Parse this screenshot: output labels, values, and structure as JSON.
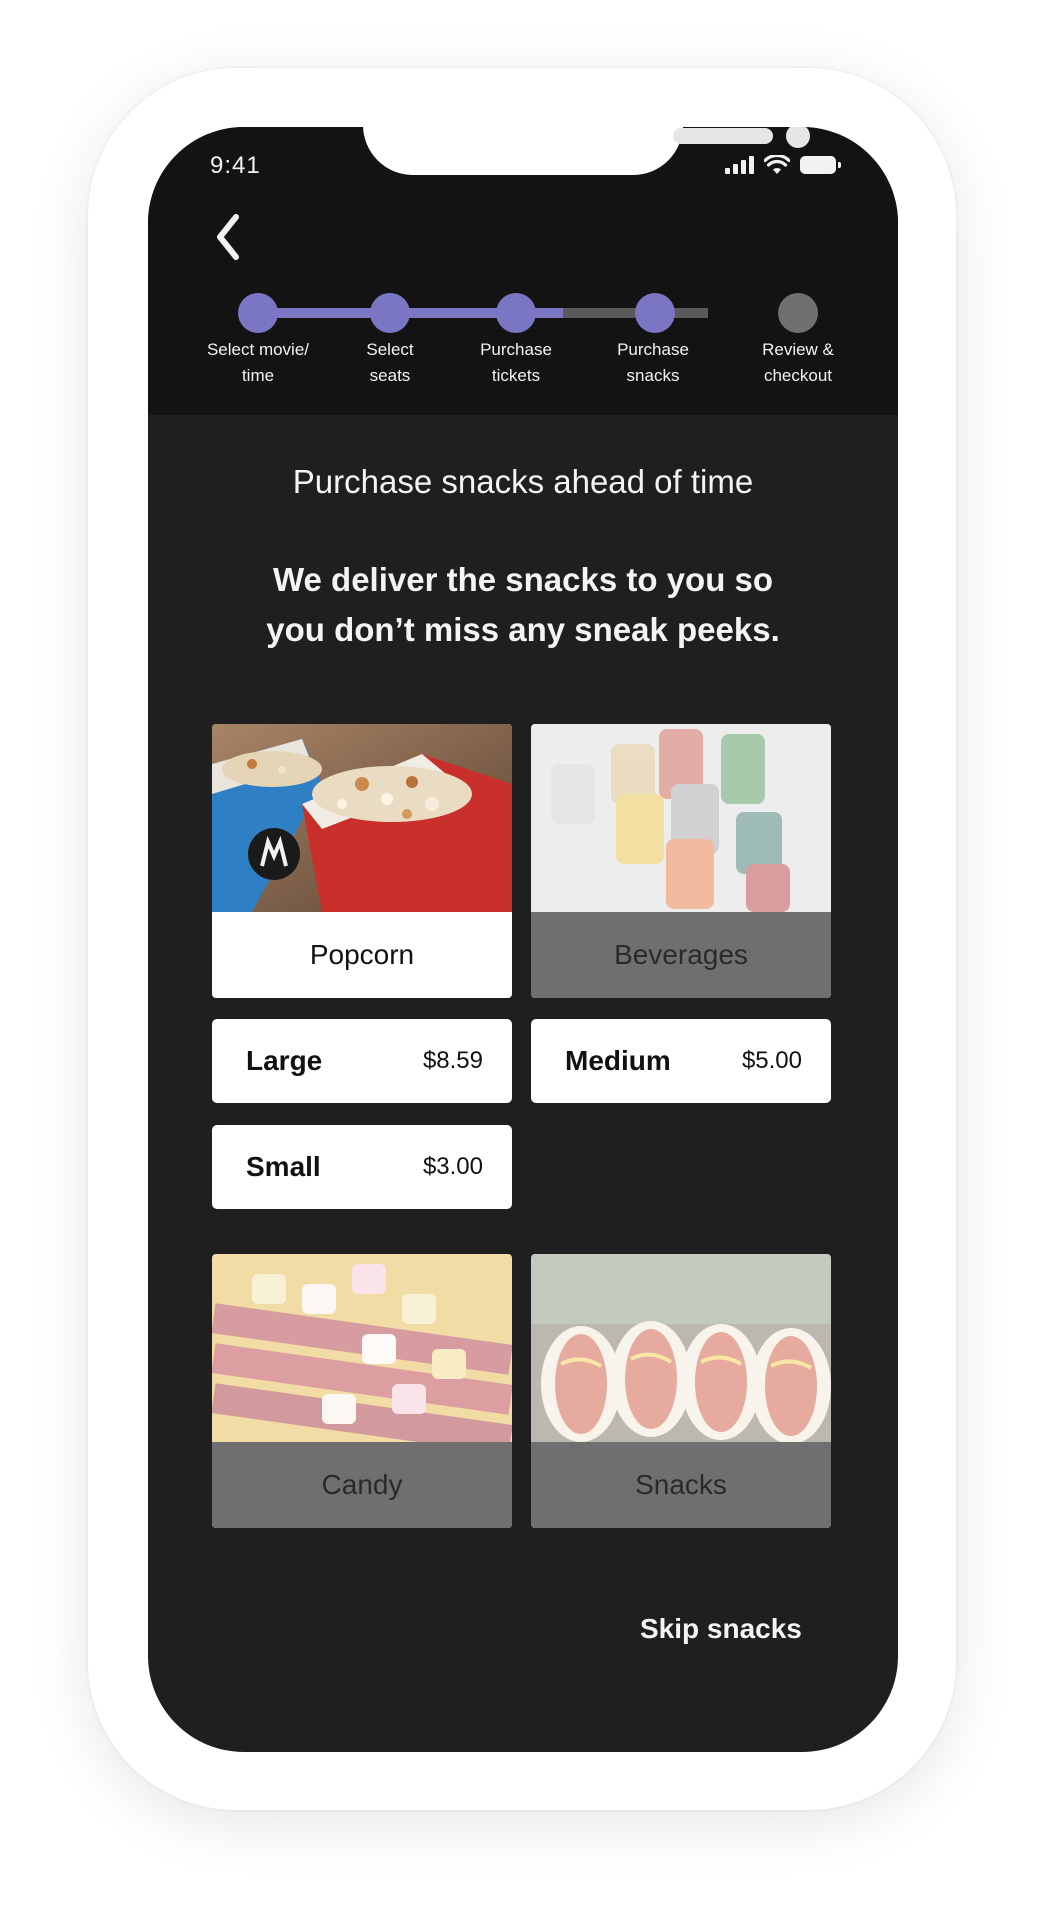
{
  "status_bar": {
    "time": "9:41",
    "icons": [
      "signal-icon",
      "wifi-icon",
      "battery-icon"
    ]
  },
  "nav": {
    "back_icon": "chevron-left-icon"
  },
  "progress": {
    "active_color": "#7b76c4",
    "inactive_color": "#5a5a5a",
    "inactive_dot_color": "#707070",
    "steps": [
      {
        "label": "Select movie/\ntime",
        "completed": true
      },
      {
        "label": "Select\nseats",
        "completed": true
      },
      {
        "label": "Purchase\ntickets",
        "completed": true
      },
      {
        "label": "Purchase\nsnacks",
        "completed": true,
        "current": true
      },
      {
        "label": "Review &\ncheckout",
        "completed": false
      }
    ]
  },
  "main": {
    "heading": "Purchase snacks ahead of time",
    "subheading": "We deliver the snacks to you so\nyou don’t miss any sneak peeks."
  },
  "categories": [
    {
      "label": "Popcorn",
      "selected": true
    },
    {
      "label": "Beverages",
      "selected": false
    },
    {
      "label": "Candy",
      "selected": false
    },
    {
      "label": "Snacks",
      "selected": false
    }
  ],
  "popcorn_options": [
    {
      "size": "Large",
      "price": "$8.59"
    },
    {
      "size": "Medium",
      "price": "$5.00"
    },
    {
      "size": "Small",
      "price": "$3.00"
    }
  ],
  "skip_label": "Skip snacks"
}
